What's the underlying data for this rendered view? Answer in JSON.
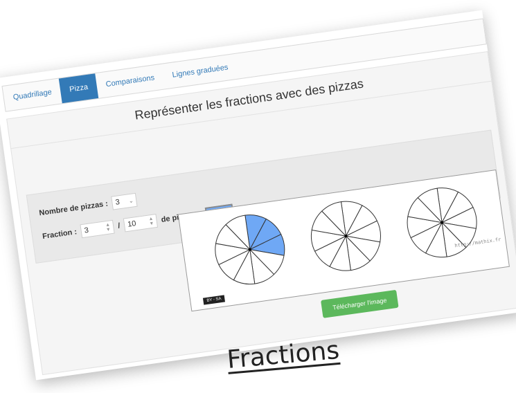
{
  "tabs": [
    {
      "label": "Quadrillage",
      "active": false
    },
    {
      "label": "Pizza",
      "active": true
    },
    {
      "label": "Comparaisons",
      "active": false
    },
    {
      "label": "Lignes graduées",
      "active": false
    }
  ],
  "page": {
    "title": "Représenter les fractions avec des pizzas"
  },
  "form": {
    "pizzas_label": "Nombre de pizzas :",
    "pizzas_value": "3",
    "fraction_label": "Fraction :",
    "numerator": "3",
    "slash": "/",
    "denominator": "10",
    "unit_label": "de pizza en",
    "color": "#6fa8f5"
  },
  "canvas": {
    "slices_per_pizza": 10,
    "filled_slices": 3,
    "pizza_count": 3,
    "cc_badge": "BY - SA",
    "watermark": "http://mathix.fr"
  },
  "download_label": "Télécharger l'image",
  "caption": "Fractions"
}
